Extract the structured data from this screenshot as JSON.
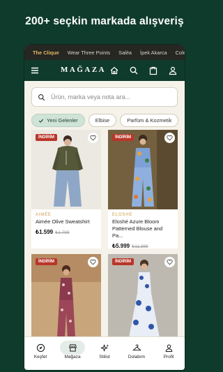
{
  "promo": {
    "headline": "200+ seçkin markada alışveriş"
  },
  "top_tabs": [
    "The Clique",
    "Wear Three Points",
    "Salèa",
    "İpek Akarca",
    "Colección"
  ],
  "header": {
    "logo": "MAĞAZA"
  },
  "search": {
    "placeholder": "Ürün, marka veya nota ara..."
  },
  "filters": [
    "Yeni Gelenler",
    "Elbise",
    "Parfüm & Kozmetik"
  ],
  "products": [
    {
      "badge": "İNDİRİM",
      "brand": "AIMÉE",
      "name": "Aimée Olive Sweatshirt",
      "price": "₺1.599",
      "old_price": "₺1.799"
    },
    {
      "badge": "İNDİRİM",
      "brand": "ELOSHE",
      "name": "Eloshé Azure Bloom Patterned Blouse and Pa...",
      "price": "₺5.999",
      "old_price": "₺11.399"
    },
    {
      "badge": "İNDİRİM",
      "brand": "",
      "name": "",
      "price": "",
      "old_price": ""
    },
    {
      "badge": "İNDİRİM",
      "brand": "",
      "name": "",
      "price": "",
      "old_price": ""
    }
  ],
  "bottom_nav": [
    {
      "label": "Keşfet",
      "icon": "compass-icon"
    },
    {
      "label": "Mağaza",
      "icon": "store-icon",
      "active": true
    },
    {
      "label": "Stilist",
      "icon": "sparkles-icon"
    },
    {
      "label": "Dolabım",
      "icon": "hanger-icon"
    },
    {
      "label": "Profil",
      "icon": "user-icon"
    }
  ],
  "colors": {
    "brand_green": "#0f3b2c",
    "accent_gold": "#e2b864",
    "sale_red": "#b8362a",
    "chip_active": "#cfe3d6"
  }
}
